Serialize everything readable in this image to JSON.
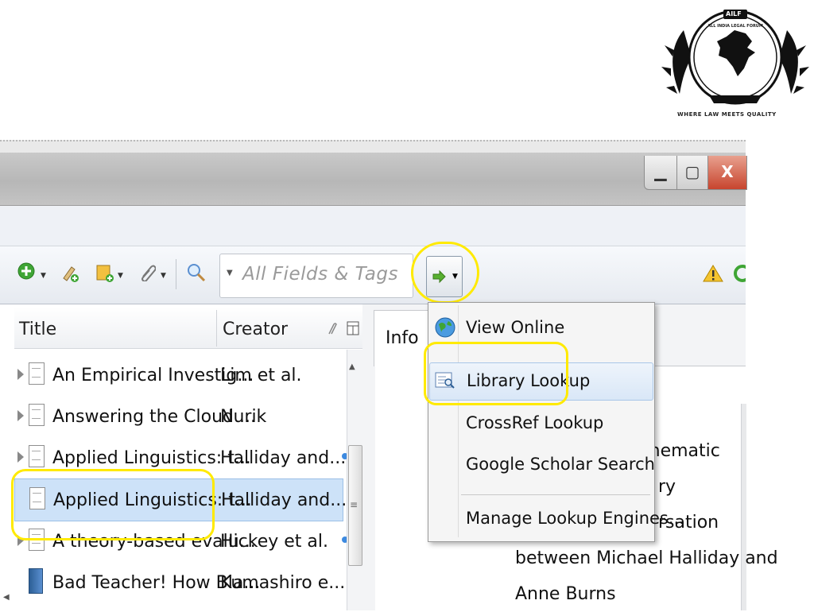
{
  "logo": {
    "badge": "AILF",
    "name": "ALL INDIA LEGAL FORUM",
    "tagline": "WHERE LAW MEETS QUALITY"
  },
  "window": {
    "minimize_glyph": "▁",
    "maximize_glyph": "▢",
    "close_glyph": "X"
  },
  "toolbar": {
    "search_placeholder": "All Fields & Tags",
    "icons": [
      "new-item-icon",
      "new-note-icon",
      "add-by-identifier-icon",
      "attachment-icon",
      "advanced-search-icon",
      "locate-icon",
      "warning-icon",
      "sync-icon"
    ]
  },
  "items_table": {
    "headers": {
      "title": "Title",
      "creator": "Creator"
    },
    "rows": [
      {
        "title": "An Empirical Investig...",
        "creator": "Lim et al.",
        "expandable": true,
        "type": "document",
        "selected": false,
        "has_dot": false
      },
      {
        "title": "Answering the Cloud ...",
        "creator": "Nurik",
        "expandable": true,
        "type": "document",
        "selected": false,
        "has_dot": false
      },
      {
        "title": "Applied Linguistics: t...",
        "creator": "Halliday and...",
        "expandable": true,
        "type": "document",
        "selected": false,
        "has_dot": true
      },
      {
        "title": "Applied Linguistics: t...",
        "creator": "Halliday and...",
        "expandable": false,
        "type": "document",
        "selected": true,
        "has_dot": false
      },
      {
        "title": "A theory-based evalu...",
        "creator": "Hickey et al.",
        "expandable": true,
        "type": "document",
        "selected": false,
        "has_dot": true
      },
      {
        "title": "Bad Teacher! How Bla...",
        "creator": "Kumashiro e...",
        "expandable": false,
        "type": "book",
        "selected": false,
        "has_dot": false
      }
    ]
  },
  "item_pane": {
    "tab_info": "Info",
    "abstract_lines": [
      "thematic",
      "ry",
      "rsation",
      "between Michael Halliday and",
      "Anne Burns"
    ]
  },
  "lookup_menu": {
    "items": [
      {
        "label": "View Online",
        "icon": "globe-icon"
      },
      {
        "label": "Library Lookup",
        "icon": "library-lookup-icon"
      },
      {
        "label": "CrossRef Lookup",
        "icon": ""
      },
      {
        "label": "Google Scholar Search",
        "icon": ""
      }
    ],
    "manage": "Manage Lookup Engines..."
  },
  "colors": {
    "highlight": "#ffea00",
    "selection": "#cde2f8",
    "accent_blue": "#3d8ae0"
  }
}
